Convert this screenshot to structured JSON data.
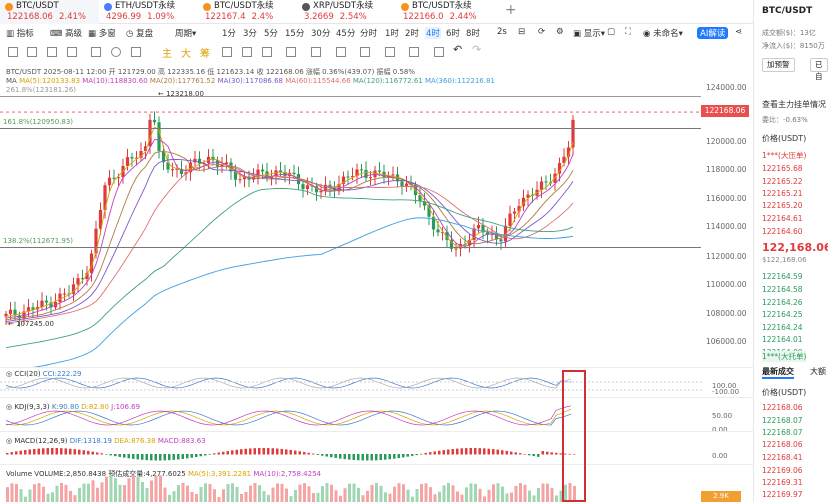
{
  "tabs": [
    {
      "name": "BTC/USDT",
      "price": "122168.06",
      "change": "2.41%",
      "active": true
    },
    {
      "name": "ETH/USDT永续",
      "price": "4296.99",
      "change": "1.09%"
    },
    {
      "name": "BTC/USDT永续",
      "price": "122167.4",
      "change": "2.4%"
    },
    {
      "name": "XRP/USDT永续",
      "price": "3.2669",
      "change": "2.54%"
    },
    {
      "name": "BTC/USDT永续",
      "price": "122166.0",
      "change": "2.44%"
    }
  ],
  "add_tab": "+",
  "toolbar": {
    "indicator": "指标",
    "advanced": "高级",
    "multi": "多窗",
    "replay": "复盘",
    "period": "周期",
    "intervals": [
      "1分",
      "3分",
      "5分",
      "15分",
      "30分",
      "45分",
      "分时",
      "1时",
      "2时",
      "4时",
      "6时",
      "8时"
    ],
    "active_interval": "4时",
    "countdown": "2s",
    "display": "显示",
    "unnamed": "未命名",
    "ai": "AI解读"
  },
  "draw_chars": [
    "主",
    "大",
    "筹"
  ],
  "chart_info": {
    "line1": "BTC/USDT 2025-08-11 12:00 开 121729.00 高 122335.16 低 121623.14 收 122168.06 涨幅 0.36%(439.07) 振幅 0.58%",
    "fib_top": "261.8%(123181.26)",
    "ma_label": "MA",
    "ma5": "MA(5):120133.83",
    "ma10": "MA(10):118830.60",
    "ma20": "MA(20):117761.52",
    "ma30": "MA(30):117086.68",
    "ma60": "MA(60):115544.66",
    "ma120": "MA(120):116772.61",
    "ma360": "MA(360):112216.81"
  },
  "fib_levels": {
    "f1618": "161.8%(120950.83)",
    "f1382": "138.2%(112671.95)"
  },
  "price_axis": [
    "124000.00",
    "122000.00",
    "120000.00",
    "118000.00",
    "116000.00",
    "114000.00",
    "112000.00",
    "110000.00",
    "108000.00",
    "106000.00"
  ],
  "current_price": "122168.06",
  "high_mark": "123218.00",
  "low_mark": "107245.00",
  "cci": {
    "label": "CCI(20)",
    "value": "CCI:222.29",
    "axis": [
      "100.00",
      "-100.00"
    ]
  },
  "kdj": {
    "label": "KDJ(9,3,3)",
    "k": "K:90.80",
    "d": "D:82.80",
    "j": "J:106.69",
    "axis": [
      "50.00",
      "0.00"
    ]
  },
  "macd": {
    "label": "MACD(12,26,9)",
    "dif": "DIF:1318.19",
    "dea": "DEA:876.38",
    "macd": "MACD:883.63",
    "axis": [
      "0.00"
    ]
  },
  "volume": {
    "label": "Volume",
    "vol": "VOLUME:2,850.8438",
    "est": "预估成交量:4,277.6025",
    "ma5": "MA(5):3,391.2281",
    "ma10": "MA(10):2,758.4254",
    "badge": "2.9K"
  },
  "right_panel": {
    "title": "BTC/USDT",
    "line1": "成交额($)：13亿",
    "line2": "净流入($)：8150万",
    "btn1": "加预警",
    "btn2": "已自",
    "section": "查看主力挂单情况",
    "ratio": "委比：-0.63%",
    "price_head": "价格(USDT)",
    "big_ask": "1***(大压单)",
    "asks": [
      "122165.68",
      "122165.22",
      "122165.21",
      "122165.20",
      "122164.61",
      "122164.60"
    ],
    "last": "122,168.06",
    "last_sub": "$122,168.06",
    "bids": [
      "122164.59",
      "122164.58",
      "122164.26",
      "122164.25",
      "122164.24",
      "122164.01",
      "122164.00"
    ],
    "big_bid": "1***(大托单)",
    "tab_trades": "最新成交",
    "tab_big": "大额",
    "trade_head": "价格(USDT)",
    "trades": [
      "122168.06",
      "122168.07",
      "122168.07",
      "122168.06",
      "122168.41",
      "122169.06",
      "122169.31",
      "122169.97"
    ]
  },
  "colors": {
    "up": "#e03a3a",
    "down": "#2a9a5a",
    "accent": "#1f7aff"
  }
}
